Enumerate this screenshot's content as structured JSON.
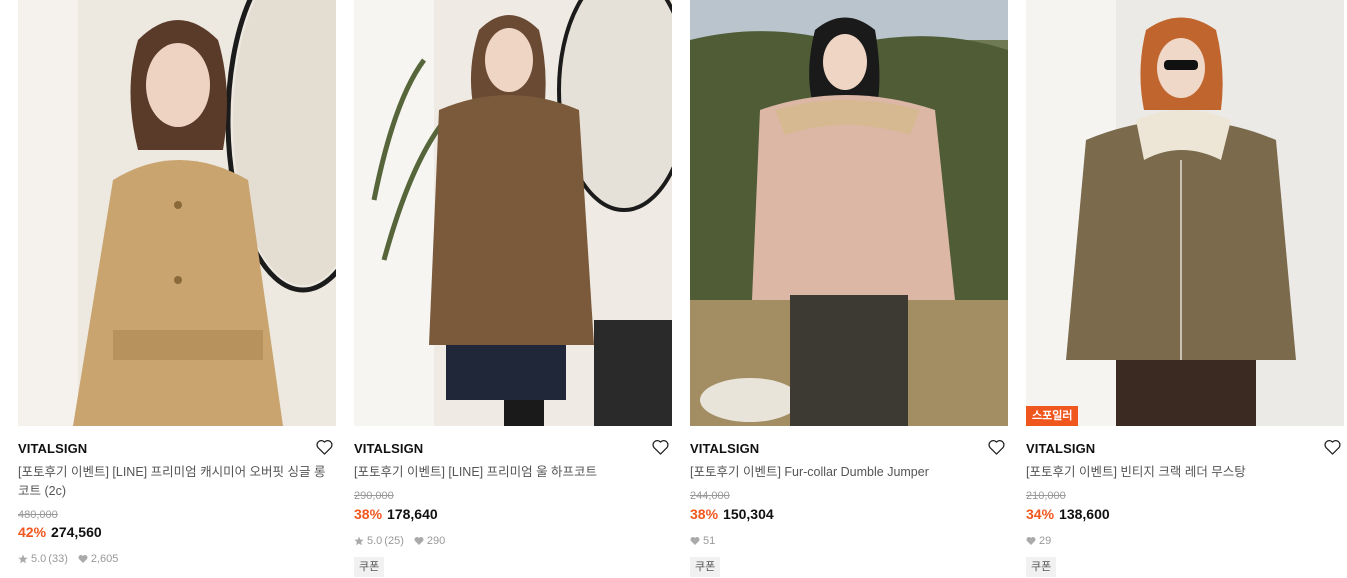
{
  "products": [
    {
      "brand": "VITALSIGN",
      "title": "[포토후기 이벤트] [LINE] 프리미엄 캐시미어 오버핏 싱글 롱코트 (2c)",
      "original_price": "480,000",
      "discount": "42%",
      "price": "274,560",
      "rating": "5.0",
      "review_count": "(33)",
      "likes": "2,605",
      "image_desc": "beige belted wool coat",
      "colors": {
        "garment": "#c9a46e",
        "bg": "#e9e3da"
      }
    },
    {
      "brand": "VITALSIGN",
      "title": "[포토후기 이벤트] [LINE] 프리미엄 울 하프코트",
      "original_price": "290,000",
      "discount": "38%",
      "price": "178,640",
      "rating": "5.0",
      "review_count": "(25)",
      "likes": "290",
      "coupon": "쿠폰",
      "colors": {
        "garment": "#7a5a3a",
        "bg": "#ece7df"
      }
    },
    {
      "brand": "VITALSIGN",
      "title": "[포토후기 이벤트] Fur-collar Dumble Jumper",
      "original_price": "244,000",
      "discount": "38%",
      "price": "150,304",
      "likes": "51",
      "coupon": "쿠폰",
      "colors": {
        "garment": "#dcb7a6",
        "bg": "#6f7a55"
      }
    },
    {
      "brand": "VITALSIGN",
      "title": "[포토후기 이벤트] 빈티지 크랙 레더 무스탕",
      "original_price": "210,000",
      "discount": "34%",
      "price": "138,600",
      "likes": "29",
      "coupon": "쿠폰",
      "badge": "스포일러",
      "colors": {
        "garment": "#7b6a4c",
        "bg": "#eceae6"
      }
    }
  ],
  "accent_color": "#f0571e"
}
